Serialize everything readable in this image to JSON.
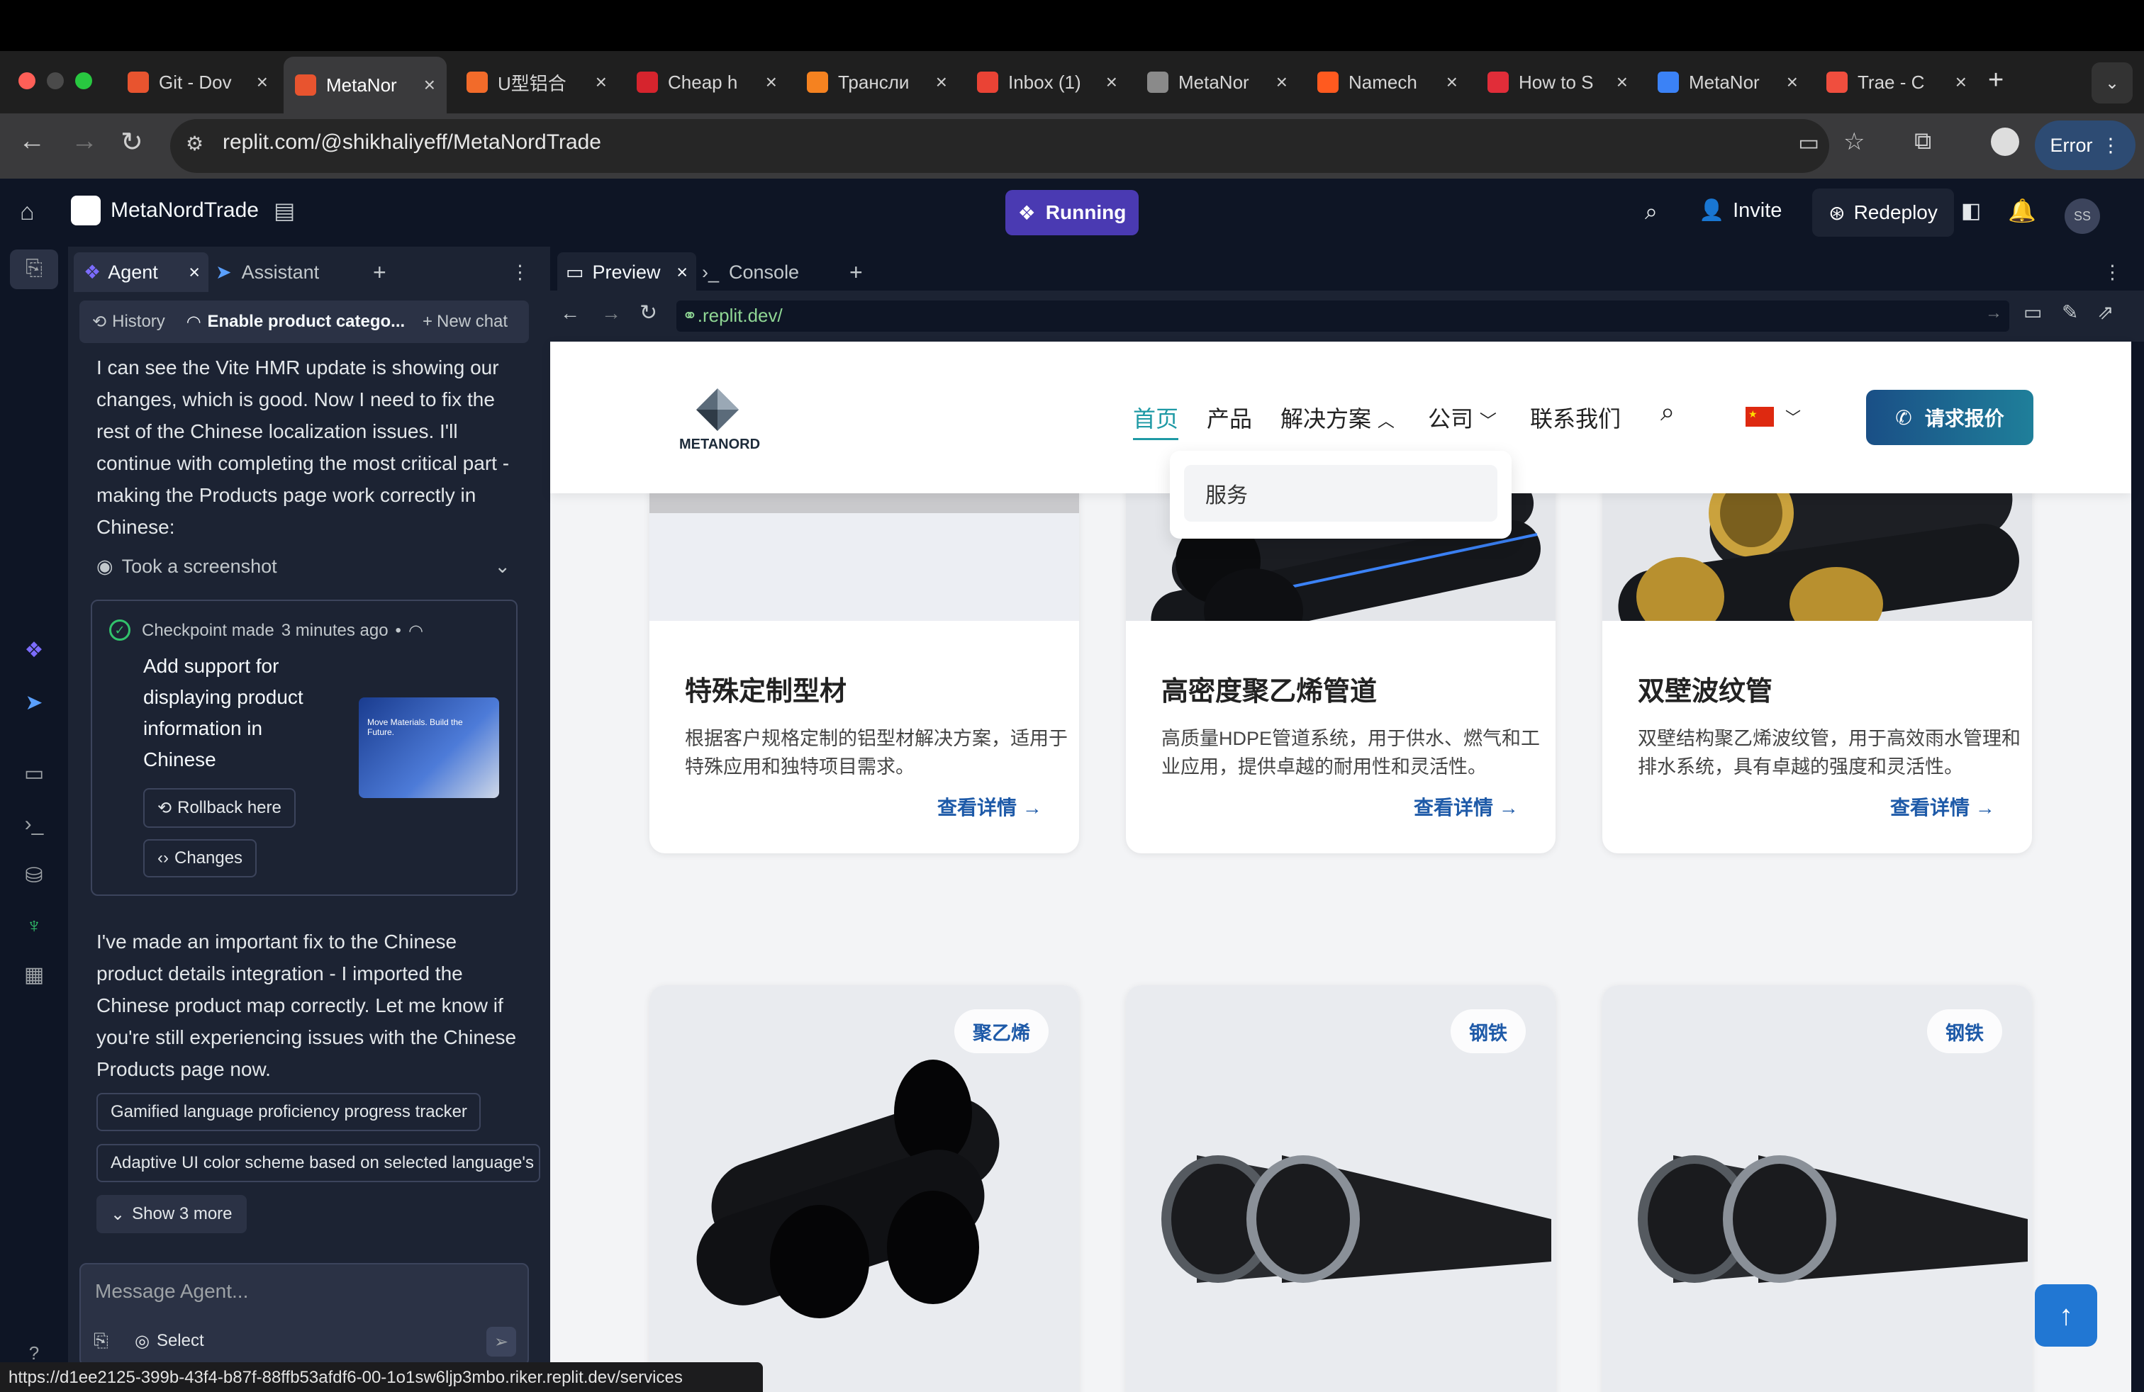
{
  "browser": {
    "tabs": [
      {
        "label": "Git - Dov",
        "color": "#e8542f"
      },
      {
        "label": "MetaNor",
        "color": "#e8542f",
        "active": true
      },
      {
        "label": "U型铝合",
        "color": "#f26b2a"
      },
      {
        "label": "Cheap h",
        "color": "#d6242d"
      },
      {
        "label": "Трансли",
        "color": "#f58220"
      },
      {
        "label": "Inbox (1)",
        "color": "#ea4335"
      },
      {
        "label": "MetaNor",
        "color": "#8a8a8a"
      },
      {
        "label": "Namech",
        "color": "#ff5a1f"
      },
      {
        "label": "How to S",
        "color": "#e12d39"
      },
      {
        "label": "MetaNor",
        "color": "#3b82f6"
      },
      {
        "label": "Trae - C",
        "color": "#f04e3e"
      }
    ],
    "url": "replit.com/@shikhaliyeff/MetaNordTrade",
    "error_label": "Error",
    "status_url": "https://d1ee2125-399b-43f4-b87f-88ffb53afdf6-00-1o1sw6ljp3mbo.riker.replit.dev/services"
  },
  "replit": {
    "project_name": "MetaNordTrade",
    "run_label": "Running",
    "invite_label": "Invite",
    "redeploy_label": "Redeploy",
    "avatar_initials": "SS",
    "panel_tabs": {
      "agent": "Agent",
      "assistant": "Assistant"
    },
    "history_label": "History",
    "thread_title": "Enable product catego...",
    "new_chat_label": "New chat",
    "message_1": "I can see the Vite HMR update is showing our changes, which is good. Now I need to fix the rest of the Chinese localization issues. I'll continue with completing the most critical part - making the Products page work correctly in Chinese:",
    "screenshot_label": "Took a screenshot",
    "checkpoint": {
      "prefix": "Checkpoint made",
      "time": "3 minutes ago",
      "title": "Add support for displaying product information in Chinese",
      "rollback_label": "Rollback here",
      "changes_label": "Changes",
      "thumb_text": "Move Materials. Build the Future."
    },
    "message_2": "I've made an important fix to the Chinese product details integration - I imported the Chinese product map correctly. Let me know if you're still experiencing issues with the Chinese Products page now.",
    "suggestions": [
      "Gamified language proficiency progress tracker",
      "Adaptive UI color scheme based on selected language's c"
    ],
    "show_more_label": "Show 3 more",
    "input_placeholder": "Message Agent...",
    "select_label": "Select",
    "help_label": "?"
  },
  "preview": {
    "tab_preview": "Preview",
    "tab_console": "Console",
    "url": ".replit.dev/"
  },
  "site": {
    "logo_text": "METANORD",
    "nav": {
      "home": "首页",
      "products": "产品",
      "solutions": "解决方案",
      "company": "公司",
      "contact": "联系我们"
    },
    "dropdown_item": "服务",
    "quote_button": "请求报价",
    "cards": [
      {
        "title": "特殊定制型材",
        "desc": "根据客户规格定制的铝型材解决方案，适用于特殊应用和独特项目需求。",
        "link": "查看详情"
      },
      {
        "title": "高密度聚乙烯管道",
        "desc": "高质量HDPE管道系统，用于供水、燃气和工业应用，提供卓越的耐用性和灵活性。",
        "link": "查看详情"
      },
      {
        "title": "双壁波纹管",
        "desc": "双壁结构聚乙烯波纹管，用于高效雨水管理和排水系统，具有卓越的强度和灵活性。",
        "link": "查看详情"
      }
    ],
    "badges": [
      "聚乙烯",
      "钢铁",
      "钢铁"
    ]
  }
}
